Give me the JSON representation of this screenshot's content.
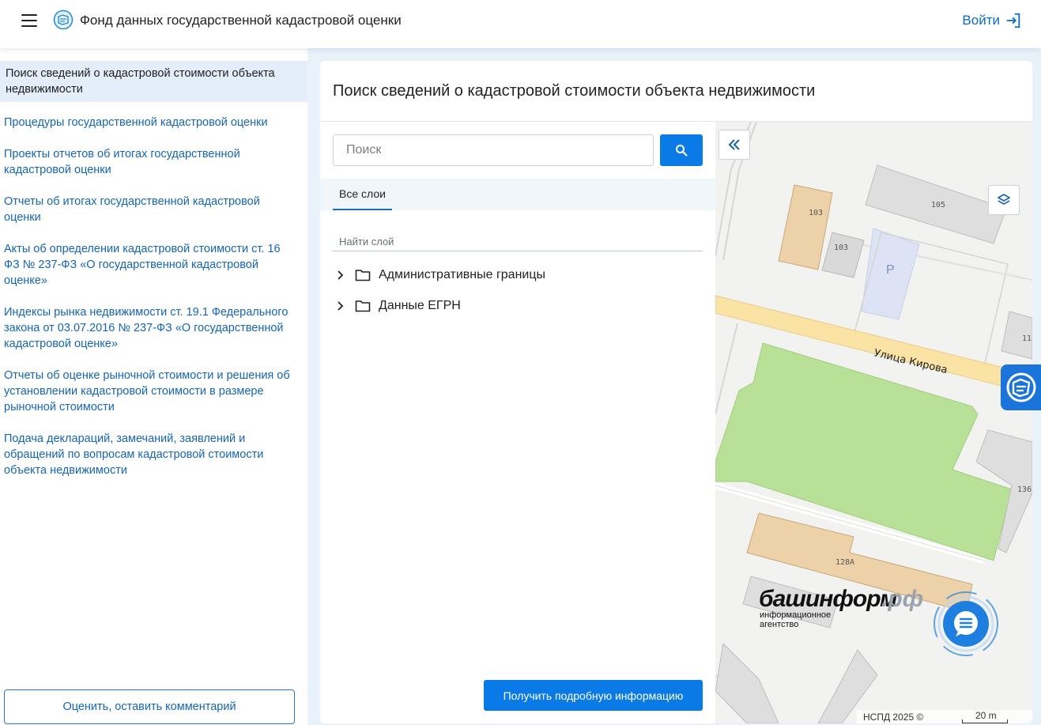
{
  "header": {
    "title": "Фонд данных государственной кадастровой оценки",
    "login_label": "Войти"
  },
  "sidebar": {
    "items": [
      {
        "label": "Поиск сведений о кадастровой стоимости объекта недвижимости",
        "active": true
      },
      {
        "label": "Процедуры государственной кадастровой оценки"
      },
      {
        "label": "Проекты отчетов об итогах государственной кадастровой оценки"
      },
      {
        "label": "Отчеты об итогах государственной кадастровой оценки"
      },
      {
        "label": "Акты об определении кадастровой стоимости ст. 16 ФЗ № 237-ФЗ «О государственной кадастровой оценке»"
      },
      {
        "label": "Индексы рынка недвижимости ст. 19.1 Федерального закона от 03.07.2016 № 237-ФЗ «О государственной кадастровой оценке»"
      },
      {
        "label": "Отчеты об оценке рыночной стоимости и решения об установлении кадастровой стоимости в размере рыночной стоимости"
      },
      {
        "label": "Подача деклараций, замечаний, заявлений и обращений по вопросам кадастровой стоимости объекта недвижимости"
      }
    ],
    "rate_button": "Оценить, оставить комментарий"
  },
  "panel": {
    "title": "Поиск сведений о кадастровой стоимости объекта недвижимости",
    "search": {
      "placeholder": "Поиск",
      "value": ""
    },
    "tabs": [
      {
        "label": "Все слои",
        "active": true
      }
    ],
    "layer_filter_placeholder": "Найти слой",
    "layers": [
      {
        "label": "Административные границы"
      },
      {
        "label": "Данные ЕГРН"
      }
    ],
    "detail_button": "Получить подробную информацию"
  },
  "map": {
    "street_label": "Улица Кирова",
    "building_numbers": [
      "103",
      "103",
      "105",
      "11",
      "136",
      "128А"
    ],
    "parking_label": "P",
    "attribution": "НСПД 2025 ©",
    "scale_label": "20 m",
    "watermark": {
      "brand": "башинформ",
      "domain": ".рф",
      "line1": "информационное",
      "line2": "агентство"
    },
    "colors": {
      "building_beige": "#edd1a8",
      "building_grey": "#d9d9d9",
      "park_green": "#b8e096",
      "road_yellow": "#fbe3a6",
      "parking_blue": "#dde3f5"
    }
  },
  "icons": {
    "menu": "hamburger-icon",
    "logo": "cadastre-logo-icon",
    "login": "login-arrow-icon",
    "search": "search-icon",
    "collapse": "double-chevron-left-icon",
    "layers": "layers-icon",
    "chevron": "chevron-right-icon",
    "folder": "folder-icon",
    "chat": "chat-icon"
  },
  "theme": {
    "accent": "#0a7ae6",
    "link": "#1565b5",
    "active_bg": "#e3eefa",
    "page_bg": "#e9f1f9"
  }
}
